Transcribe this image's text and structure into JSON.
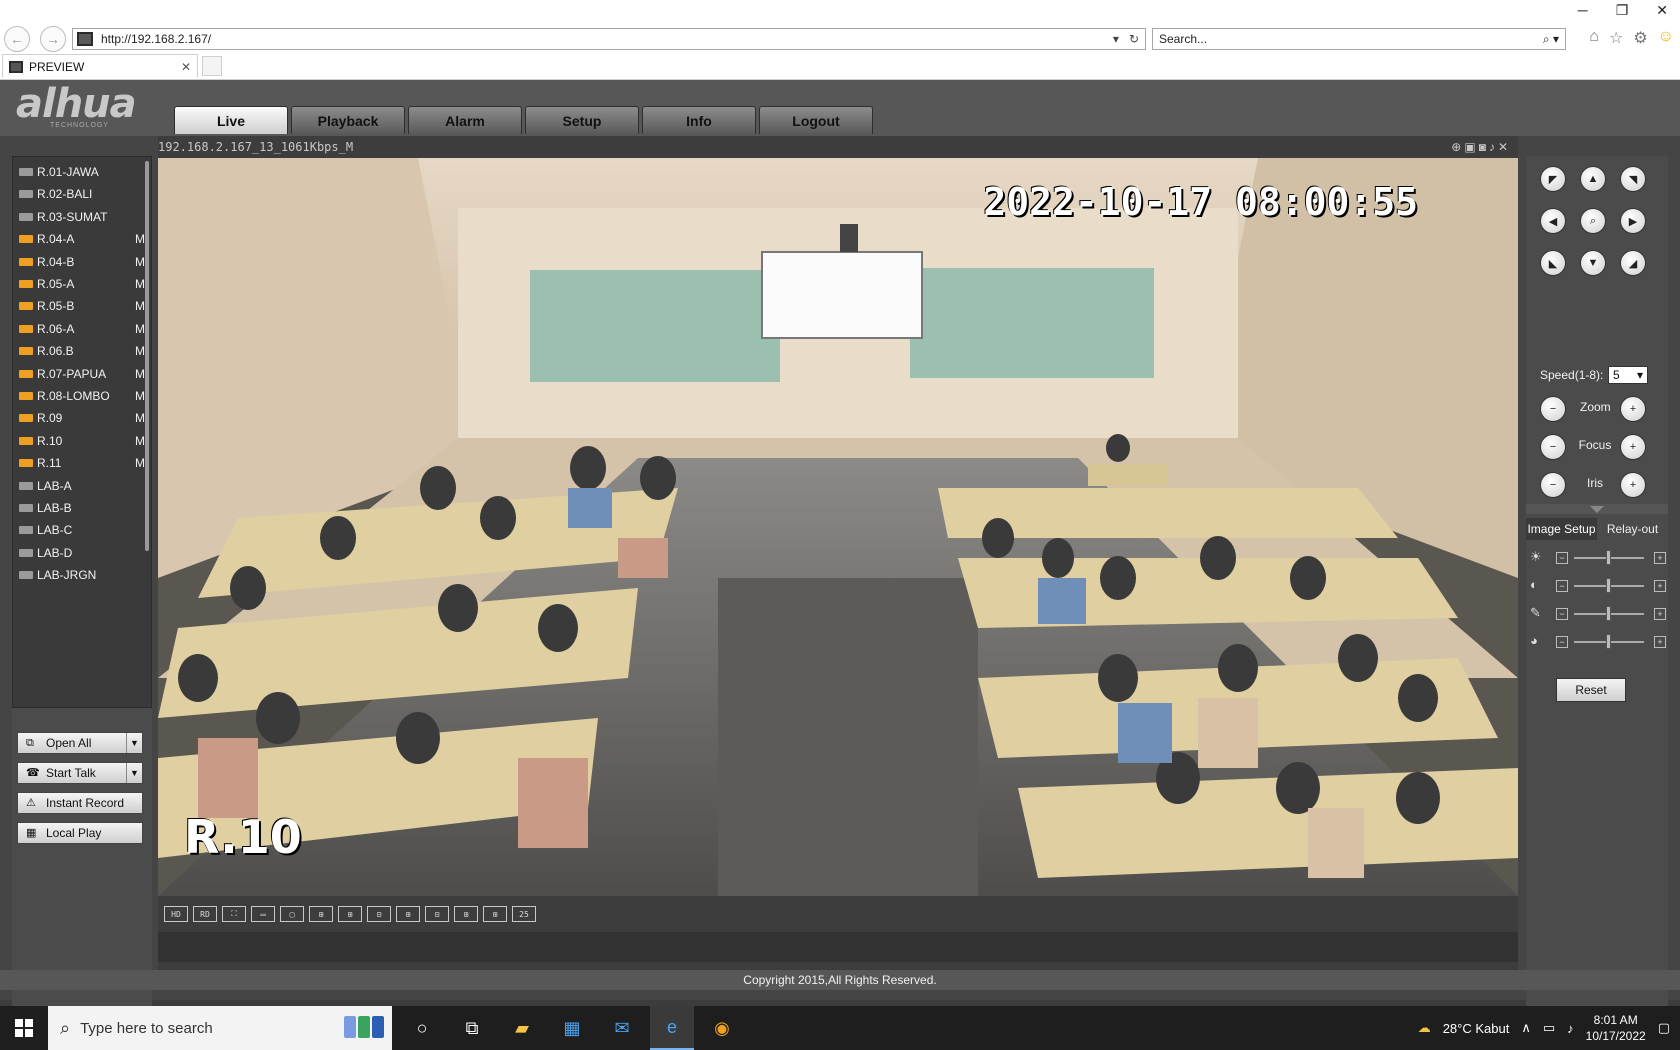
{
  "browser": {
    "url": "http://192.168.2.167/",
    "search_placeholder": "Search...",
    "tab_title": "PREVIEW",
    "tab_close": "✕"
  },
  "menu": [
    {
      "label": "Live",
      "active": true
    },
    {
      "label": "Playback"
    },
    {
      "label": "Alarm"
    },
    {
      "label": "Setup"
    },
    {
      "label": "Info"
    },
    {
      "label": "Logout"
    }
  ],
  "logo": {
    "brand": "alhua",
    "sub": "TECHNOLOGY"
  },
  "channels": [
    {
      "name": "R.01-JAWA",
      "active": false,
      "mark": ""
    },
    {
      "name": "R.02-BALI",
      "active": false,
      "mark": ""
    },
    {
      "name": "R.03-SUMAT",
      "active": false,
      "mark": ""
    },
    {
      "name": "R.04-A",
      "active": true,
      "mark": "M"
    },
    {
      "name": "R.04-B",
      "active": true,
      "mark": "M"
    },
    {
      "name": "R.05-A",
      "active": true,
      "mark": "M"
    },
    {
      "name": "R.05-B",
      "active": true,
      "mark": "M"
    },
    {
      "name": "R.06-A",
      "active": true,
      "mark": "M"
    },
    {
      "name": "R.06.B",
      "active": true,
      "mark": "M"
    },
    {
      "name": "R.07-PAPUA",
      "active": true,
      "mark": "M"
    },
    {
      "name": "R.08-LOMBO",
      "active": true,
      "mark": "M"
    },
    {
      "name": "R.09",
      "active": true,
      "mark": "M"
    },
    {
      "name": "R.10",
      "active": true,
      "mark": "M"
    },
    {
      "name": "R.11",
      "active": true,
      "mark": "M"
    },
    {
      "name": "LAB-A",
      "active": false,
      "mark": ""
    },
    {
      "name": "LAB-B",
      "active": false,
      "mark": ""
    },
    {
      "name": "LAB-C",
      "active": false,
      "mark": ""
    },
    {
      "name": "LAB-D",
      "active": false,
      "mark": ""
    },
    {
      "name": "LAB-JRGN",
      "active": false,
      "mark": ""
    }
  ],
  "left_buttons": {
    "open_all": "Open All",
    "start_talk": "Start Talk",
    "instant_record": "Instant Record",
    "local_play": "Local Play"
  },
  "video": {
    "stream_title": "192.168.2.167_13_1061Kbps_M",
    "timestamp": "2022-10-17 08:00:55",
    "camera_label": "R.10",
    "layout_buttons": [
      "HD",
      "RD",
      "⛶",
      "▭",
      "▢",
      "⊞",
      "⊞",
      "⊟",
      "⊞",
      "⊟",
      "⊞",
      "⊞",
      "25"
    ]
  },
  "ptz": {
    "speed_label": "Speed(1-8):",
    "speed_value": "5",
    "zoom": "Zoom",
    "focus": "Focus",
    "iris": "Iris"
  },
  "image_setup": {
    "tab_image": "Image Setup",
    "tab_relay": "Relay-out",
    "sliders": [
      {
        "icon": "brightness-icon",
        "value": 0.5
      },
      {
        "icon": "contrast-icon",
        "value": 0.5
      },
      {
        "icon": "saturation-icon",
        "value": 0.5
      },
      {
        "icon": "hue-icon",
        "value": 0.5
      }
    ],
    "reset": "Reset"
  },
  "footer": {
    "copyright": "Copyright 2015,All Rights Reserved."
  },
  "taskbar": {
    "search_placeholder": "Type here to search",
    "weather": "28°C  Kabut",
    "time": "8:01 AM",
    "date": "10/17/2022"
  }
}
